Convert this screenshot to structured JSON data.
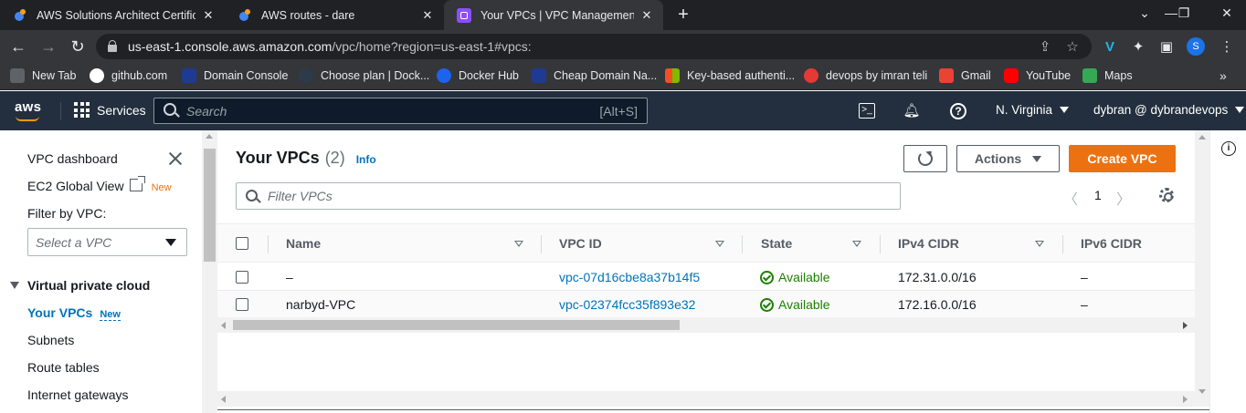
{
  "browser": {
    "tabs": [
      {
        "title": "AWS Solutions Architect Certificat",
        "icon": "aws-favicon"
      },
      {
        "title": "AWS routes - dare",
        "icon": "aws-favicon"
      },
      {
        "title": "Your VPCs | VPC Management Co",
        "icon": "vpc-favicon",
        "active": true
      }
    ],
    "url_host": "us-east-1.console.aws.amazon.com",
    "url_path": "/vpc/home?region=us-east-1#vpcs:",
    "profile_initial": "S",
    "bookmarks": [
      {
        "label": "New Tab",
        "color": "#9aa0a6"
      },
      {
        "label": "github.com",
        "color": "#ffffff"
      },
      {
        "label": "Domain Console",
        "color": "#1f3a93"
      },
      {
        "label": "Choose plan | Dock...",
        "color": "#2d3a4a"
      },
      {
        "label": "Docker Hub",
        "color": "#1d63ed"
      },
      {
        "label": "Cheap Domain Na...",
        "color": "#1f3a93"
      },
      {
        "label": "Key-based authenti...",
        "color": "#f25022"
      },
      {
        "label": "devops by imran teli",
        "color": "#e53935"
      },
      {
        "label": "Gmail",
        "color": "#ea4335"
      },
      {
        "label": "YouTube",
        "color": "#ff0000"
      },
      {
        "label": "Maps",
        "color": "#34a853"
      }
    ]
  },
  "aws_nav": {
    "logo": "aws",
    "services": "Services",
    "search_placeholder": "Search",
    "search_shortcut": "[Alt+S]",
    "region": "N. Virginia",
    "user": "dybran @ dybrandevops"
  },
  "sidebar": {
    "dashboard": "VPC dashboard",
    "global_view": "EC2 Global View",
    "new_badge": "New",
    "filter_label": "Filter by VPC:",
    "filter_placeholder": "Select a VPC",
    "section": "Virtual private cloud",
    "items": [
      {
        "label": "Your VPCs",
        "active": true,
        "badge": "New"
      },
      {
        "label": "Subnets"
      },
      {
        "label": "Route tables"
      },
      {
        "label": "Internet gateways"
      }
    ]
  },
  "main": {
    "title": "Your VPCs",
    "count": "(2)",
    "info": "Info",
    "actions_label": "Actions",
    "create_label": "Create VPC",
    "filter_placeholder": "Filter VPCs",
    "page": "1",
    "columns": [
      "Name",
      "VPC ID",
      "State",
      "IPv4 CIDR",
      "IPv6 CIDR"
    ],
    "rows": [
      {
        "name": "–",
        "vpc_id": "vpc-07d16cbe8a37b14f5",
        "state": "Available",
        "ipv4": "172.31.0.0/16",
        "ipv6": "–"
      },
      {
        "name": "narbyd-VPC",
        "vpc_id": "vpc-02374fcc35f893e32",
        "state": "Available",
        "ipv4": "172.16.0.0/16",
        "ipv6": "–"
      }
    ]
  },
  "colors": {
    "aws_nav_bg": "#232f3e",
    "primary_button": "#ec7211",
    "link": "#0073bb",
    "status_ok": "#1d8102"
  }
}
